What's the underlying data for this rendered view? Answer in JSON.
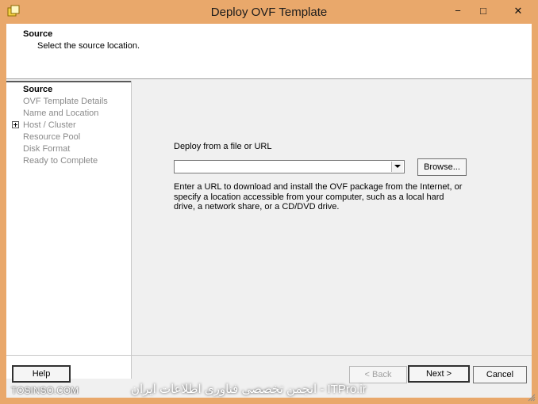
{
  "window": {
    "title": "Deploy OVF Template",
    "controls": {
      "minimize": "−",
      "maximize": "□",
      "close": "✕"
    },
    "icon": "ovf-app-icon"
  },
  "header": {
    "title": "Source",
    "subtitle": "Select the source location."
  },
  "steps": [
    {
      "label": "Source",
      "active": true
    },
    {
      "label": "OVF Template Details",
      "active": false
    },
    {
      "label": "Name and Location",
      "active": false
    },
    {
      "label": "Host / Cluster",
      "active": false,
      "expandable": true
    },
    {
      "label": "Resource Pool",
      "active": false
    },
    {
      "label": "Disk Format",
      "active": false
    },
    {
      "label": "Ready to Complete",
      "active": false
    }
  ],
  "main": {
    "label": "Deploy from a file or URL",
    "url_value": "",
    "browse_label": "Browse...",
    "description": "Enter a URL to download and install the OVF package from the Internet, or specify a location accessible from your computer, such as a local hard drive, a network share, or a CD/DVD drive."
  },
  "footer": {
    "help_label": "Help",
    "back_label": "< Back",
    "next_label": "Next >",
    "cancel_label": "Cancel"
  },
  "watermark": {
    "left": "TOSINSO.COM",
    "right": "ITPro.ir - انجمن تخصصی فناوری اطلاعات ایران"
  },
  "colors": {
    "titlebar": "#e9a86b",
    "client": "#f0f0f0",
    "step_inactive": "#8a8a8a"
  }
}
